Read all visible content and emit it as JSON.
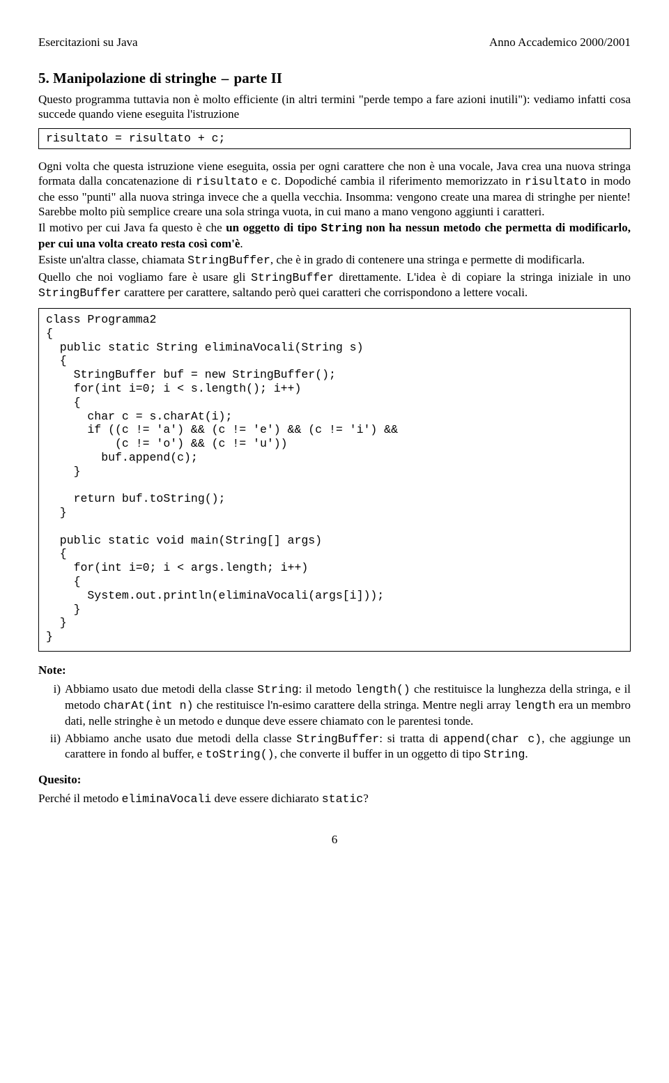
{
  "header": {
    "left": "Esercitazioni su Java",
    "right": "Anno Accademico 2000/2001"
  },
  "section": {
    "number": "5.",
    "title": "Manipolazione di stringhe",
    "subtitle": "parte II"
  },
  "intro": "Questo programma tuttavia non è molto efficiente (in altri termini \"perde tempo a fare azioni inutili\"): vediamo infatti cosa succede quando viene eseguita l'istruzione",
  "code_inline": "risultato = risultato + c;",
  "para2_a": "Ogni volta che questa istruzione viene eseguita, ossia per ogni carattere che non è una vocale, Java crea una nuova stringa formata dalla concatenazione di ",
  "para2_code1": "risultato",
  "para2_b": " e ",
  "para2_code2": "c",
  "para2_c": ". Dopodiché cambia il riferimento memorizzato in ",
  "para2_code3": "risultato",
  "para2_d": " in modo che esso \"punti\" alla nuova stringa invece che a quella vecchia. Insomma: vengono create una marea di stringhe per niente! Sarebbe molto più semplice creare una sola stringa vuota, in cui mano a mano vengono aggiunti i caratteri.",
  "para3_a": "Il motivo per cui Java fa questo è che ",
  "para3_b": "un oggetto di tipo ",
  "para3_code1": "String",
  "para3_c": " non ha nessun metodo che permetta di modificarlo, per cui una volta creato resta così com'è",
  "para3_d": ".",
  "para4_a": "Esiste un'altra classe, chiamata ",
  "para4_code1": "StringBuffer",
  "para4_b": ", che è in grado di contenere una stringa e permette di modificarla.",
  "para5_a": "Quello che noi vogliamo fare è usare gli ",
  "para5_code1": "StringBuffer",
  "para5_b": " direttamente. L'idea è di copiare la stringa iniziale in uno ",
  "para5_code2": "StringBuffer",
  "para5_c": " carattere per carattere, saltando però quei caratteri che corrispondono a lettere vocali.",
  "code_block": "class Programma2\n{\n  public static String eliminaVocali(String s)\n  {\n    StringBuffer buf = new StringBuffer();\n    for(int i=0; i < s.length(); i++)\n    {\n      char c = s.charAt(i);\n      if ((c != 'a') && (c != 'e') && (c != 'i') &&\n          (c != 'o') && (c != 'u'))\n        buf.append(c);\n    }\n\n    return buf.toString();\n  }\n\n  public static void main(String[] args)\n  {\n    for(int i=0; i < args.length; i++)\n    {\n      System.out.println(eliminaVocali(args[i]));\n    }\n  }\n}",
  "notes_label": "Note:",
  "notes": [
    {
      "idx": "i)",
      "a": "Abbiamo usato due metodi della classe ",
      "c1": "String",
      "b": ": il metodo ",
      "c2": "length()",
      "c": " che restituisce la lunghezza della stringa, e il metodo ",
      "c3": "charAt(int n)",
      "d": " che restituisce l'n-esimo carattere della stringa. Mentre negli array ",
      "c4": "length",
      "e": " era un membro dati, nelle stringhe è un metodo e dunque deve essere chiamato con le parentesi tonde."
    },
    {
      "idx": "ii)",
      "a": "Abbiamo anche usato due metodi della classe ",
      "c1": "StringBuffer",
      "b": ": si tratta di ",
      "c2": "append(char c)",
      "c": ", che aggiunge un carattere in fondo al buffer, e ",
      "c3": "toString()",
      "d": ", che converte il buffer in un oggetto di tipo ",
      "c4": "String",
      "e": "."
    }
  ],
  "quesito_label": "Quesito:",
  "quesito_a": "Perché il metodo ",
  "quesito_code1": "eliminaVocali",
  "quesito_b": " deve essere dichiarato ",
  "quesito_code2": "static",
  "quesito_c": "?",
  "page_number": "6"
}
